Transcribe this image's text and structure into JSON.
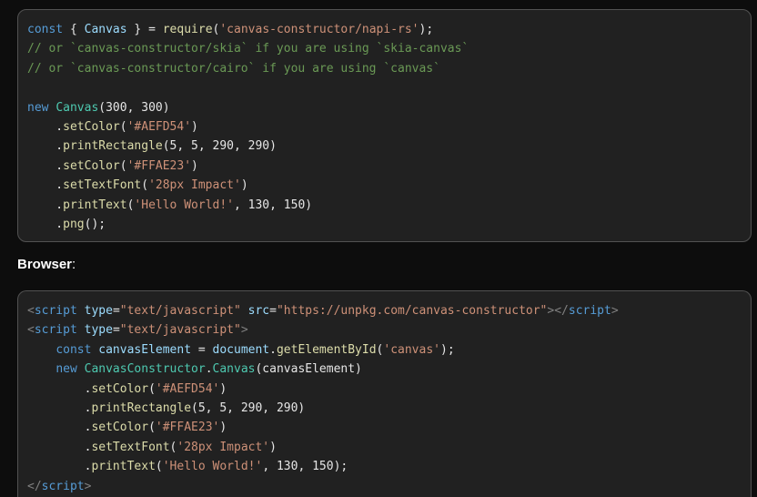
{
  "colors": {
    "page_background": "#0d0d0d",
    "code_background": "#212121",
    "code_border": "#525252",
    "text": "#e6e6e6",
    "keyword": "#569cd6",
    "string": "#ce9178",
    "comment": "#6a9955",
    "function": "#dcdcaa",
    "class": "#4ec9b0",
    "tag": "#569cd6",
    "attribute": "#9cdcfe",
    "punctuation": "#808080",
    "heading": "#ffffff"
  },
  "heading": {
    "label": "Browser",
    "colon": ":"
  },
  "blocks": [
    {
      "lines": [
        [
          [
            "const",
            "keyword"
          ],
          [
            " { ",
            "text"
          ],
          [
            "Canvas",
            "attribute"
          ],
          [
            " } = ",
            "text"
          ],
          [
            "require",
            "function"
          ],
          [
            "(",
            "text"
          ],
          [
            "'canvas-constructor/napi-rs'",
            "string"
          ],
          [
            ");",
            "text"
          ]
        ],
        [
          [
            "// or `canvas-constructor/skia` if you are using `skia-canvas`",
            "comment"
          ]
        ],
        [
          [
            "// or `canvas-constructor/cairo` if you are using `canvas`",
            "comment"
          ]
        ],
        [],
        [
          [
            "new",
            "keyword"
          ],
          [
            " ",
            "text"
          ],
          [
            "Canvas",
            "class"
          ],
          [
            "(300, 300)",
            "text"
          ]
        ],
        [
          [
            "    .",
            "text"
          ],
          [
            "setColor",
            "function"
          ],
          [
            "(",
            "text"
          ],
          [
            "'#AEFD54'",
            "string"
          ],
          [
            ")",
            "text"
          ]
        ],
        [
          [
            "    .",
            "text"
          ],
          [
            "printRectangle",
            "function"
          ],
          [
            "(5, 5, 290, 290)",
            "text"
          ]
        ],
        [
          [
            "    .",
            "text"
          ],
          [
            "setColor",
            "function"
          ],
          [
            "(",
            "text"
          ],
          [
            "'#FFAE23'",
            "string"
          ],
          [
            ")",
            "text"
          ]
        ],
        [
          [
            "    .",
            "text"
          ],
          [
            "setTextFont",
            "function"
          ],
          [
            "(",
            "text"
          ],
          [
            "'28px Impact'",
            "string"
          ],
          [
            ")",
            "text"
          ]
        ],
        [
          [
            "    .",
            "text"
          ],
          [
            "printText",
            "function"
          ],
          [
            "(",
            "text"
          ],
          [
            "'Hello World!'",
            "string"
          ],
          [
            ", 130, 150)",
            "text"
          ]
        ],
        [
          [
            "    .",
            "text"
          ],
          [
            "png",
            "function"
          ],
          [
            "();",
            "text"
          ]
        ]
      ]
    },
    {
      "lines": [
        [
          [
            "<",
            "punctuation"
          ],
          [
            "script",
            "tag"
          ],
          [
            " ",
            "text"
          ],
          [
            "type",
            "attribute"
          ],
          [
            "=",
            "text"
          ],
          [
            "\"text/javascript\"",
            "string"
          ],
          [
            " ",
            "text"
          ],
          [
            "src",
            "attribute"
          ],
          [
            "=",
            "text"
          ],
          [
            "\"https://unpkg.com/canvas-constructor\"",
            "string"
          ],
          [
            "></",
            "punctuation"
          ],
          [
            "script",
            "tag"
          ],
          [
            ">",
            "punctuation"
          ]
        ],
        [
          [
            "<",
            "punctuation"
          ],
          [
            "script",
            "tag"
          ],
          [
            " ",
            "text"
          ],
          [
            "type",
            "attribute"
          ],
          [
            "=",
            "text"
          ],
          [
            "\"text/javascript\"",
            "string"
          ],
          [
            ">",
            "punctuation"
          ]
        ],
        [
          [
            "    ",
            "text"
          ],
          [
            "const",
            "keyword"
          ],
          [
            " ",
            "text"
          ],
          [
            "canvasElement",
            "attribute"
          ],
          [
            " = ",
            "text"
          ],
          [
            "document",
            "attribute"
          ],
          [
            ".",
            "text"
          ],
          [
            "getElementById",
            "function"
          ],
          [
            "(",
            "text"
          ],
          [
            "'canvas'",
            "string"
          ],
          [
            ");",
            "text"
          ]
        ],
        [
          [
            "    ",
            "text"
          ],
          [
            "new",
            "keyword"
          ],
          [
            " ",
            "text"
          ],
          [
            "CanvasConstructor",
            "class"
          ],
          [
            ".",
            "text"
          ],
          [
            "Canvas",
            "class"
          ],
          [
            "(canvasElement)",
            "text"
          ]
        ],
        [
          [
            "        .",
            "text"
          ],
          [
            "setColor",
            "function"
          ],
          [
            "(",
            "text"
          ],
          [
            "'#AEFD54'",
            "string"
          ],
          [
            ")",
            "text"
          ]
        ],
        [
          [
            "        .",
            "text"
          ],
          [
            "printRectangle",
            "function"
          ],
          [
            "(5, 5, 290, 290)",
            "text"
          ]
        ],
        [
          [
            "        .",
            "text"
          ],
          [
            "setColor",
            "function"
          ],
          [
            "(",
            "text"
          ],
          [
            "'#FFAE23'",
            "string"
          ],
          [
            ")",
            "text"
          ]
        ],
        [
          [
            "        .",
            "text"
          ],
          [
            "setTextFont",
            "function"
          ],
          [
            "(",
            "text"
          ],
          [
            "'28px Impact'",
            "string"
          ],
          [
            ")",
            "text"
          ]
        ],
        [
          [
            "        .",
            "text"
          ],
          [
            "printText",
            "function"
          ],
          [
            "(",
            "text"
          ],
          [
            "'Hello World!'",
            "string"
          ],
          [
            ", 130, 150);",
            "text"
          ]
        ],
        [
          [
            "</",
            "punctuation"
          ],
          [
            "script",
            "tag"
          ],
          [
            ">",
            "punctuation"
          ]
        ]
      ]
    }
  ]
}
